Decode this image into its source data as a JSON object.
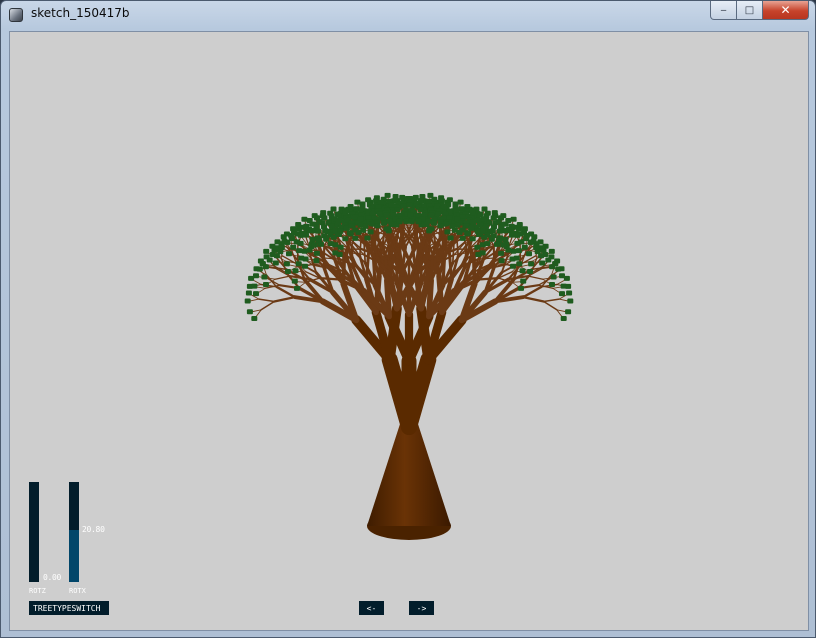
{
  "window": {
    "title": "sketch_150417b",
    "controls": {
      "minimize": "‒",
      "maximize": "□",
      "close": "✕"
    }
  },
  "colors": {
    "canvas_bg": "#cecece",
    "trunk": "#5a2a00",
    "branch": "#6b3a15",
    "leaf": "#1f5c1f",
    "control_bg": "#021d2b",
    "control_fill": "#01466a"
  },
  "controls": {
    "sliders": [
      {
        "label": "ROTZ",
        "value": "0.00",
        "fraction": 0.0
      },
      {
        "label": "ROTX",
        "value": "20.80",
        "fraction": 0.52
      }
    ],
    "buttons": {
      "tree_type": "TREETYPESWITCH",
      "prev": "<-",
      "next": "->"
    }
  },
  "icons": {
    "app": "processing-app-icon"
  }
}
